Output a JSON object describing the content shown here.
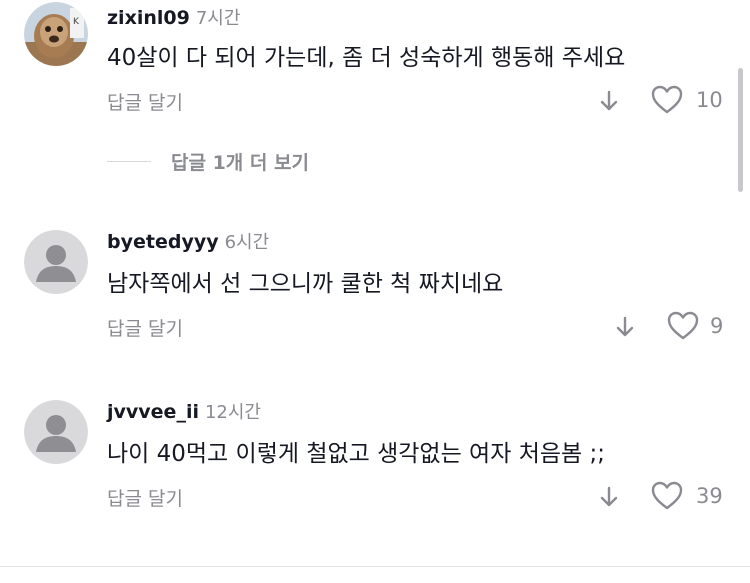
{
  "comments": [
    {
      "username": "zixinl09",
      "time": "7시간",
      "text": "40살이 다 되어 가는데, 좀 더 성숙하게 행동해 주세요",
      "reply_label": "답글 달기",
      "like_count": "10",
      "avatar": "photo-avatar"
    },
    {
      "username": "byetedyyy",
      "time": "6시간",
      "text": "남자쪽에서 선 그으니까 쿨한 척 짜치네요",
      "reply_label": "답글 달기",
      "like_count": "9",
      "avatar": "default-avatar"
    },
    {
      "username": "jvvvee_ii",
      "time": "12시간",
      "text": "나이 40먹고 이렇게 철없고 생각없는 여자 처음봄 ;;",
      "reply_label": "답글 달기",
      "like_count": "39",
      "avatar": "default-avatar"
    }
  ],
  "view_replies": "답글 1개 더 보기",
  "icons": {
    "dislike": "arrow-down-icon",
    "like": "heart-outline-icon"
  },
  "colors": {
    "text": "#161823",
    "secondary": "#8a8b91",
    "avatar_bg": "#d9d9dc",
    "avatar_fg": "#8e8e93"
  }
}
